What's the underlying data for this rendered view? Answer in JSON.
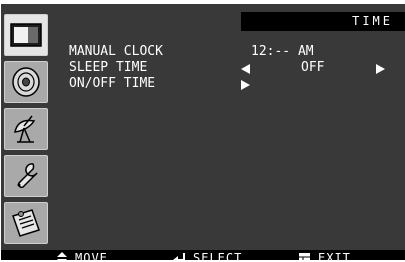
{
  "screen": {
    "title": "TIME"
  },
  "sidebar": {
    "items": [
      {
        "name": "picture",
        "icon": "tv-screen-icon",
        "active": true
      },
      {
        "name": "sound",
        "icon": "speaker-icon",
        "active": false
      },
      {
        "name": "channel",
        "icon": "satellite-dish-icon",
        "active": false
      },
      {
        "name": "setup",
        "icon": "wrench-icon",
        "active": false
      },
      {
        "name": "features",
        "icon": "clipboard-icon",
        "active": false
      }
    ]
  },
  "menu": {
    "items": [
      {
        "label": "MANUAL CLOCK",
        "value": "12:-- AM"
      },
      {
        "label": "SLEEP TIME",
        "value": "OFF"
      },
      {
        "label": "ON/OFF TIME",
        "value": ""
      }
    ]
  },
  "footer": {
    "move": "MOVE",
    "select": "SELECT",
    "exit": "EXIT"
  },
  "colors": {
    "panel": "#393939",
    "bar": "#000000",
    "text": "#ffffff"
  }
}
